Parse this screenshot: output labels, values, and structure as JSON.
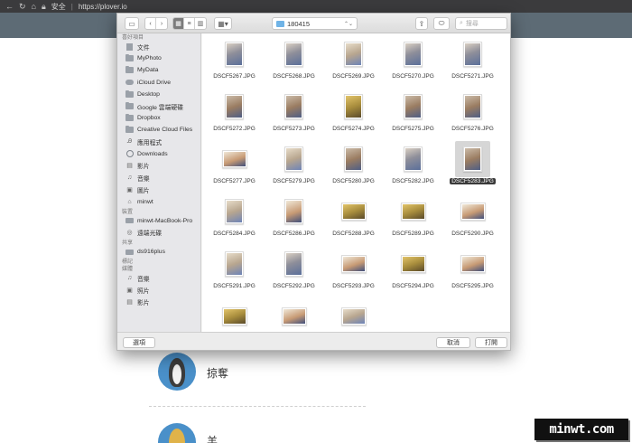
{
  "browser": {
    "security": "安全",
    "url": "https://plover.io"
  },
  "dialog": {
    "folder": "180415",
    "search_placeholder": "搜尋",
    "cancel_label": "取消",
    "open_label": "打開",
    "options_label": "選項"
  },
  "sidebar": {
    "favorites_header": "喜好項目",
    "favorites": [
      "文件",
      "MyPhoto",
      "MyData",
      "iCloud Drive",
      "Desktop",
      "Google 雲端硬碟",
      "Dropbox",
      "Creative Cloud Files",
      "應用程式",
      "Downloads",
      "影片",
      "音樂",
      "圖片",
      "minwt"
    ],
    "devices_header": "裝置",
    "devices": [
      "minwt-MacBook-Pro",
      "遠端光碟"
    ],
    "shared_header": "共享",
    "shared": [
      "ds916plus"
    ],
    "tags_header": "標記",
    "media_header": "媒體",
    "media": [
      "音樂",
      "照片",
      "影片"
    ]
  },
  "files": [
    {
      "name": "DSCF5267.JPG",
      "orientation": "portrait",
      "tone": "a"
    },
    {
      "name": "DSCF5268.JPG",
      "orientation": "portrait",
      "tone": "a"
    },
    {
      "name": "DSCF5269.JPG",
      "orientation": "portrait",
      "tone": "d"
    },
    {
      "name": "DSCF5270.JPG",
      "orientation": "portrait",
      "tone": "a"
    },
    {
      "name": "DSCF5271.JPG",
      "orientation": "portrait",
      "tone": "a"
    },
    {
      "name": "DSCF5272.JPG",
      "orientation": "portrait",
      "tone": "b"
    },
    {
      "name": "DSCF5273.JPG",
      "orientation": "portrait",
      "tone": "b"
    },
    {
      "name": "DSCF5274.JPG",
      "orientation": "portrait",
      "tone": "c"
    },
    {
      "name": "DSCF5275.JPG",
      "orientation": "portrait",
      "tone": "b"
    },
    {
      "name": "DSCF5276.JPG",
      "orientation": "portrait",
      "tone": "b"
    },
    {
      "name": "DSCF5277.JPG",
      "orientation": "landscape",
      "tone": "e"
    },
    {
      "name": "DSCF5279.JPG",
      "orientation": "portrait",
      "tone": "d"
    },
    {
      "name": "DSCF5280.JPG",
      "orientation": "portrait",
      "tone": "b"
    },
    {
      "name": "DSCF5282.JPG",
      "orientation": "portrait",
      "tone": "a"
    },
    {
      "name": "DSCF5283.JPG",
      "orientation": "portrait",
      "tone": "b",
      "selected": true
    },
    {
      "name": "DSCF5284.JPG",
      "orientation": "portrait",
      "tone": "d"
    },
    {
      "name": "DSCF5286.JPG",
      "orientation": "portrait",
      "tone": "e"
    },
    {
      "name": "DSCF5288.JPG",
      "orientation": "landscape",
      "tone": "c"
    },
    {
      "name": "DSCF5289.JPG",
      "orientation": "landscape",
      "tone": "c"
    },
    {
      "name": "DSCF5290.JPG",
      "orientation": "landscape",
      "tone": "e"
    },
    {
      "name": "DSCF5291.JPG",
      "orientation": "portrait",
      "tone": "d"
    },
    {
      "name": "DSCF5292.JPG",
      "orientation": "portrait",
      "tone": "a"
    },
    {
      "name": "DSCF5293.JPG",
      "orientation": "landscape",
      "tone": "e"
    },
    {
      "name": "DSCF5294.JPG",
      "orientation": "landscape",
      "tone": "c"
    },
    {
      "name": "DSCF5295.JPG",
      "orientation": "landscape",
      "tone": "e"
    },
    {
      "name": "",
      "orientation": "landscape",
      "tone": "c"
    },
    {
      "name": "",
      "orientation": "landscape",
      "tone": "e"
    },
    {
      "name": "",
      "orientation": "landscape",
      "tone": "d"
    }
  ],
  "page": {
    "user1_name": "掠奪",
    "user2_name": "羊"
  },
  "watermark": "minwt.com"
}
